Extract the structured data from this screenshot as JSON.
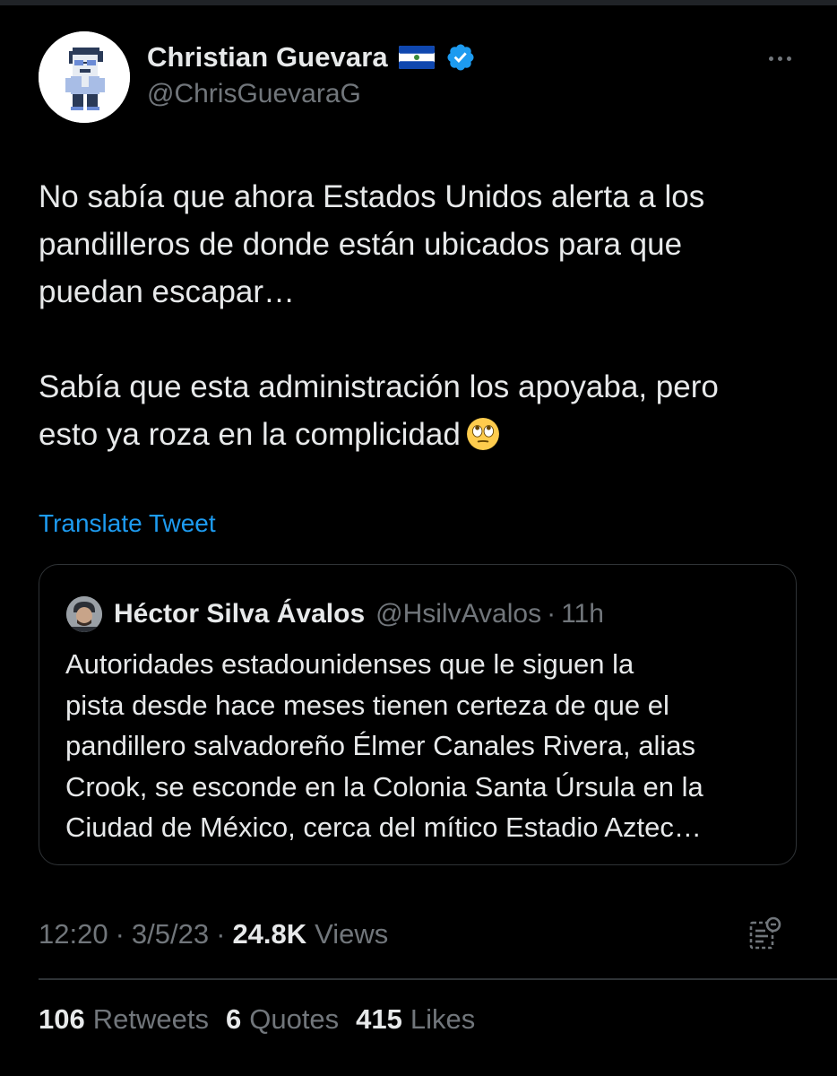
{
  "author": {
    "display_name": "Christian Guevara",
    "handle": "@ChrisGuevaraG",
    "flag_icon": "el-salvador-flag-icon",
    "verified_icon": "verified-badge-icon",
    "avatar": "pixel-art-avatar"
  },
  "tweet": {
    "paragraphs": [
      [
        "No sabía que ahora Estados Unidos alerta a los",
        "pandilleros de donde están ubicados para que",
        "puedan escapar…"
      ],
      [
        "Sabía que esta administración los apoyaba, pero",
        "esto ya roza en la complicidad"
      ]
    ],
    "emoji": "face-with-rolling-eyes-emoji",
    "translate_label": "Translate Tweet"
  },
  "quote": {
    "name": "Héctor Silva Ávalos",
    "handle": "@HsilvAvalos",
    "separator": "·",
    "time": "11h",
    "lines": [
      "Autoridades estadounidenses que le siguen la",
      "pista desde hace meses tienen certeza de que el",
      "pandillero salvadoreño Élmer Canales Rivera, alias",
      "Crook, se esconde en la Colonia Santa Úrsula en la",
      "Ciudad de México, cerca del mítico Estadio Aztec…"
    ]
  },
  "meta": {
    "time": "12:20",
    "separator": "·",
    "date": "3/5/23",
    "views_count": "24.8K",
    "views_label": "Views",
    "analytics_icon": "analytics-icon"
  },
  "stats": [
    {
      "count": "106",
      "label": "Retweets"
    },
    {
      "count": "6",
      "label": "Quotes"
    },
    {
      "count": "415",
      "label": "Likes"
    }
  ],
  "colors": {
    "background": "#000000",
    "text_primary": "#e7e9ea",
    "text_secondary": "#71767b",
    "link": "#1d9bf0",
    "border": "#2f3336",
    "verified": "#1d9bf0"
  }
}
